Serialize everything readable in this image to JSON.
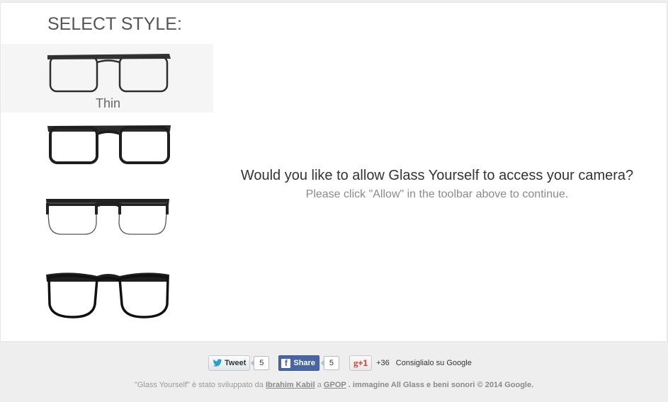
{
  "sidebar": {
    "title": "SELECT STYLE:",
    "styles": [
      {
        "label": "Thin",
        "selected": true
      },
      {
        "label": "",
        "selected": false
      },
      {
        "label": "",
        "selected": false
      },
      {
        "label": "",
        "selected": false
      }
    ]
  },
  "main": {
    "prompt_title": "Would you like to allow Glass Yourself to access your camera?",
    "prompt_subtitle": "Please click \"Allow\" in the toolbar above to continue."
  },
  "social": {
    "tweet_label": "Tweet",
    "tweet_count": "5",
    "fb_icon": "f",
    "share_label": "Share",
    "share_count": "5",
    "gplus_label": "+1",
    "gplus_count": "+36",
    "gplus_text": "Consiglialo su Google"
  },
  "footer": {
    "text_1": "\"Glass Yourself\" è stato sviluppato da",
    "author": "Ibrahim Kabil",
    "text_2": "a",
    "org": "GPOP",
    "text_3": ". immagine All Glass e beni sonori © 2014 Google."
  },
  "colors": {
    "page_bg": "#eeeeee",
    "card_bg": "#ffffff",
    "selected_bg": "#f5f5f5",
    "facebook": "#4a66a0",
    "gplus": "#d73d32"
  }
}
